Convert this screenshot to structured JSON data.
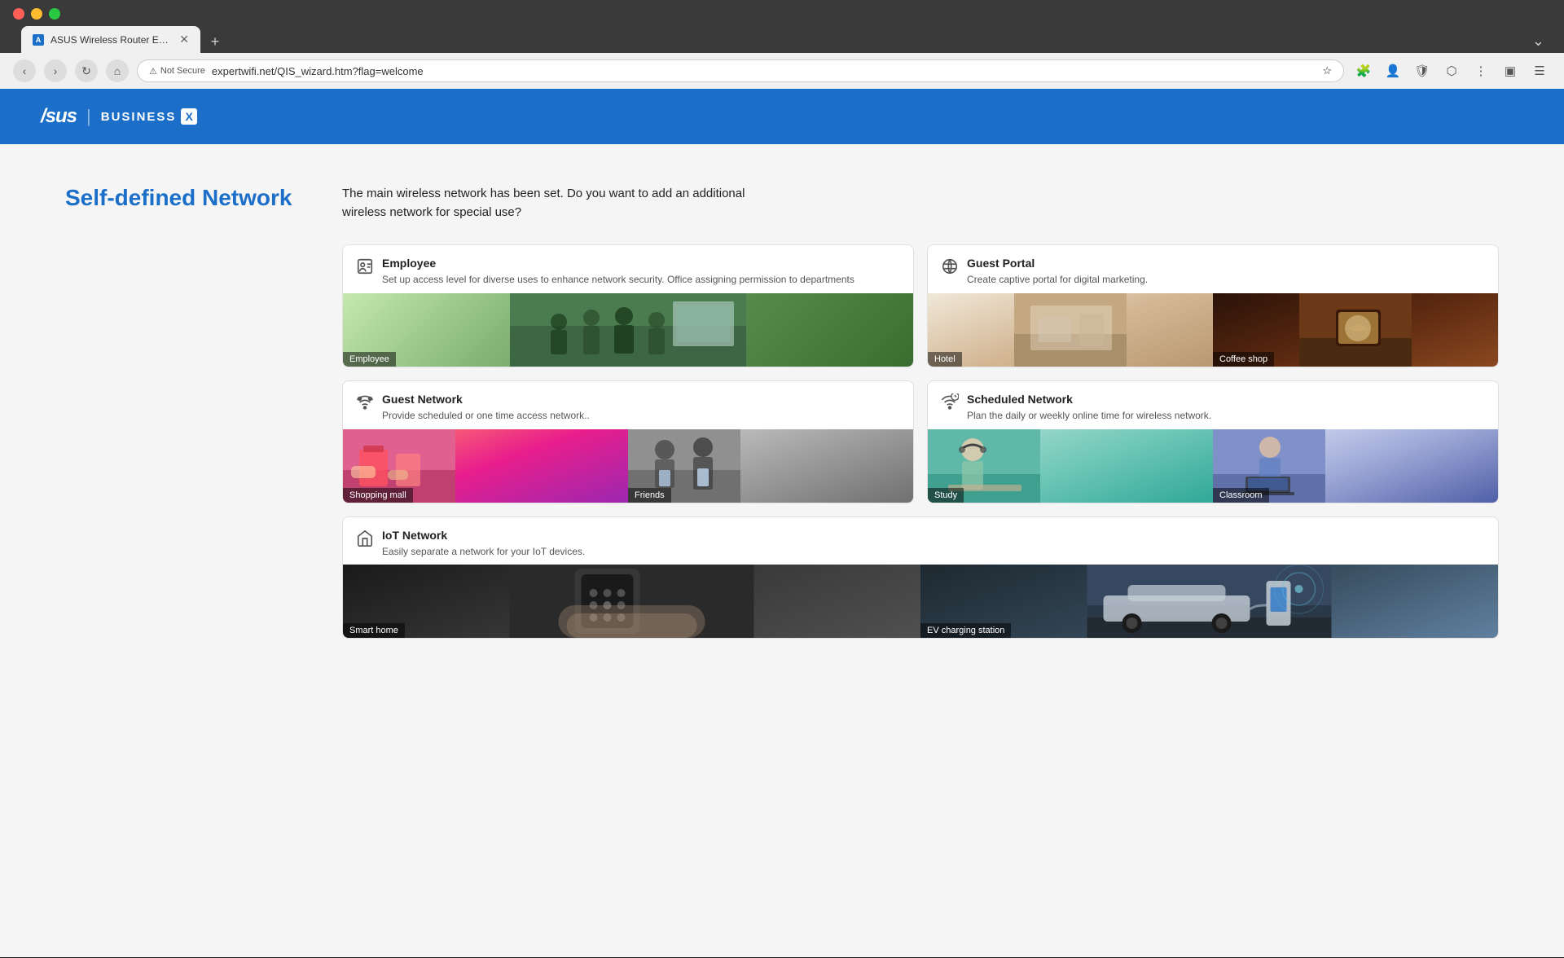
{
  "browser": {
    "tab_title": "ASUS Wireless Router Exper...",
    "url": "expertwifi.net/QIS_wizard.htm?flag=welcome",
    "not_secure_label": "Not Secure"
  },
  "header": {
    "logo_asus": "/sus",
    "logo_divider": "|",
    "logo_business": "BUSINESS",
    "logo_x": "X"
  },
  "page": {
    "sidebar_title": "Self-defined Network",
    "intro_line1": "The main wireless network has been set. Do you want to add an additional",
    "intro_line2": "wireless network for special use?"
  },
  "cards": [
    {
      "id": "employee",
      "title": "Employee",
      "desc": "Set up access level for diverse uses to enhance network security. Office assigning permission to departments",
      "icon": "person",
      "images": [
        {
          "label": "Employee",
          "color_class": "img-employee"
        }
      ],
      "full_width": false
    },
    {
      "id": "guest-portal",
      "title": "Guest Portal",
      "desc": "Create captive portal for digital marketing.",
      "icon": "portal",
      "images": [
        {
          "label": "Hotel",
          "color_class": "img-hotel"
        },
        {
          "label": "Coffee shop",
          "color_class": "img-coffee"
        }
      ],
      "full_width": false
    },
    {
      "id": "guest-network",
      "title": "Guest Network",
      "desc": "Provide scheduled or one time access network..",
      "icon": "guest",
      "images": [
        {
          "label": "Shopping mall",
          "color_class": "img-shopping"
        },
        {
          "label": "Friends",
          "color_class": "img-friends"
        }
      ],
      "full_width": false
    },
    {
      "id": "scheduled-network",
      "title": "Scheduled Network",
      "desc": "Plan the daily or weekly online time for wireless network.",
      "icon": "scheduled",
      "images": [
        {
          "label": "Study",
          "color_class": "img-study"
        },
        {
          "label": "Classroom",
          "color_class": "img-classroom"
        }
      ],
      "full_width": false
    },
    {
      "id": "iot-network",
      "title": "IoT Network",
      "desc": "Easily separate a network for your IoT devices.",
      "icon": "iot",
      "images": [
        {
          "label": "Smart home",
          "color_class": "img-smarthome"
        },
        {
          "label": "EV charging station",
          "color_class": "img-ev"
        }
      ],
      "full_width": true
    }
  ]
}
